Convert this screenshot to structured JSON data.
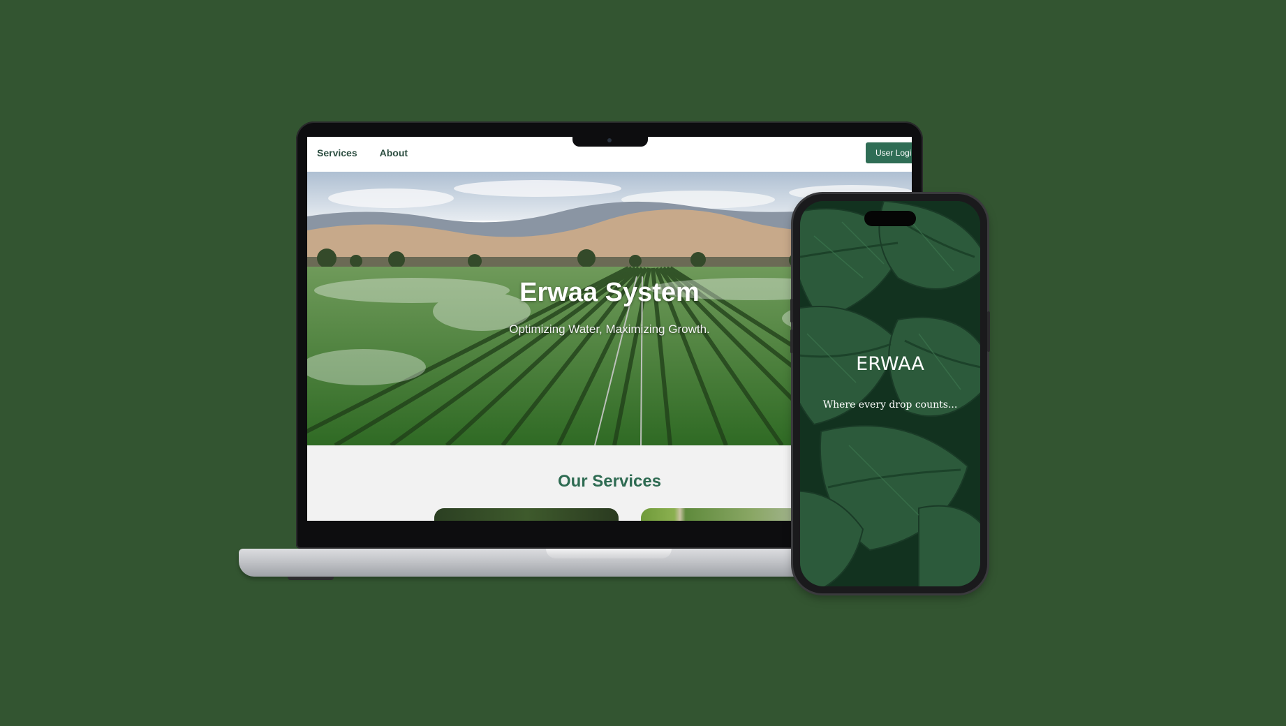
{
  "laptop": {
    "nav": {
      "links": [
        "Services",
        "About"
      ],
      "login_label": "User Login"
    },
    "hero": {
      "title": "Erwaa System",
      "subtitle": "Optimizing Water, Maximizing Growth."
    },
    "services": {
      "title": "Our Services"
    }
  },
  "phone": {
    "title": "ERWAA",
    "tagline": "Where every drop counts..."
  },
  "colors": {
    "background": "#335531",
    "brand_green": "#2f6d55",
    "heading_green": "#2e6b52"
  }
}
